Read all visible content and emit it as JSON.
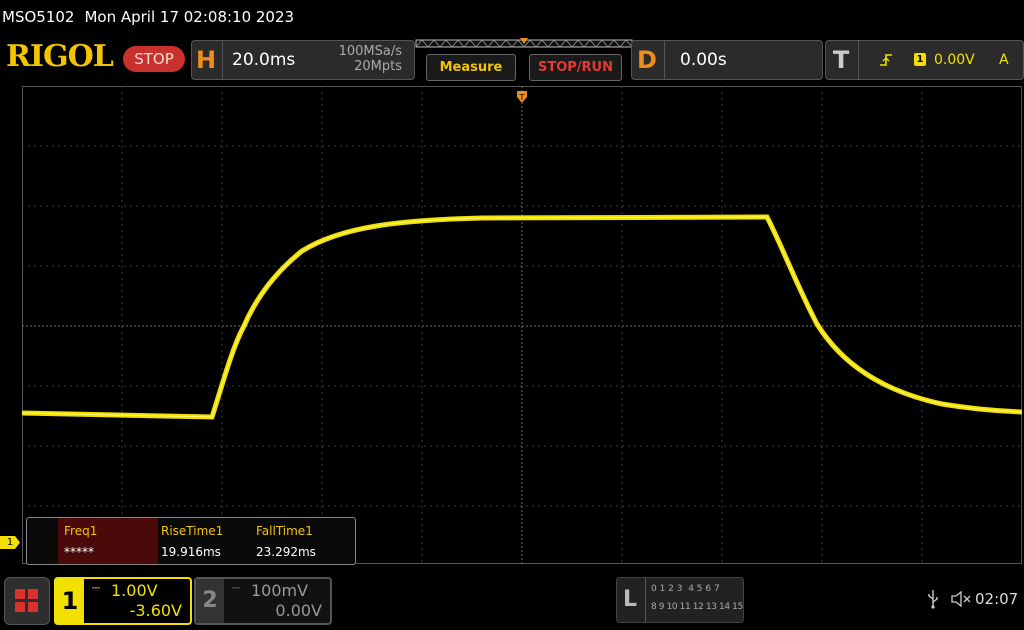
{
  "title_bar": {
    "model": "MSO5102",
    "datetime": "Mon April 17 02:08:10 2023"
  },
  "logo": "RIGOL",
  "run_state": "STOP",
  "horizontal": {
    "letter": "H",
    "timebase": "20.0ms",
    "sample_rate": "100MSa/s",
    "memory_depth": "20Mpts"
  },
  "buttons": {
    "measure": "Measure",
    "stop_run": "STOP/RUN"
  },
  "delay": {
    "letter": "D",
    "value": "0.00s"
  },
  "trigger": {
    "letter": "T",
    "source": "1",
    "level": "0.00V",
    "mode": "A"
  },
  "channel_marker": "1",
  "measurements": [
    {
      "label": "Freq1",
      "value": "*****"
    },
    {
      "label": "RiseTime1",
      "value": "19.916ms"
    },
    {
      "label": "FallTime1",
      "value": "23.292ms"
    }
  ],
  "channel1": {
    "number": "1",
    "scale": "1.00V",
    "offset": "-3.60V",
    "color": "#f2e100"
  },
  "channel2": {
    "number": "2",
    "scale": "100mV",
    "offset": "0.00V"
  },
  "logic": {
    "letter": "L",
    "row1": "0 1 2 3  4 5 6 7",
    "row2": "8 9 10 11 12 13 14 15"
  },
  "status": {
    "time": "02:07"
  },
  "colors": {
    "trace": "#f2e100",
    "accent": "#f08c1e",
    "stop": "#c8312d"
  }
}
